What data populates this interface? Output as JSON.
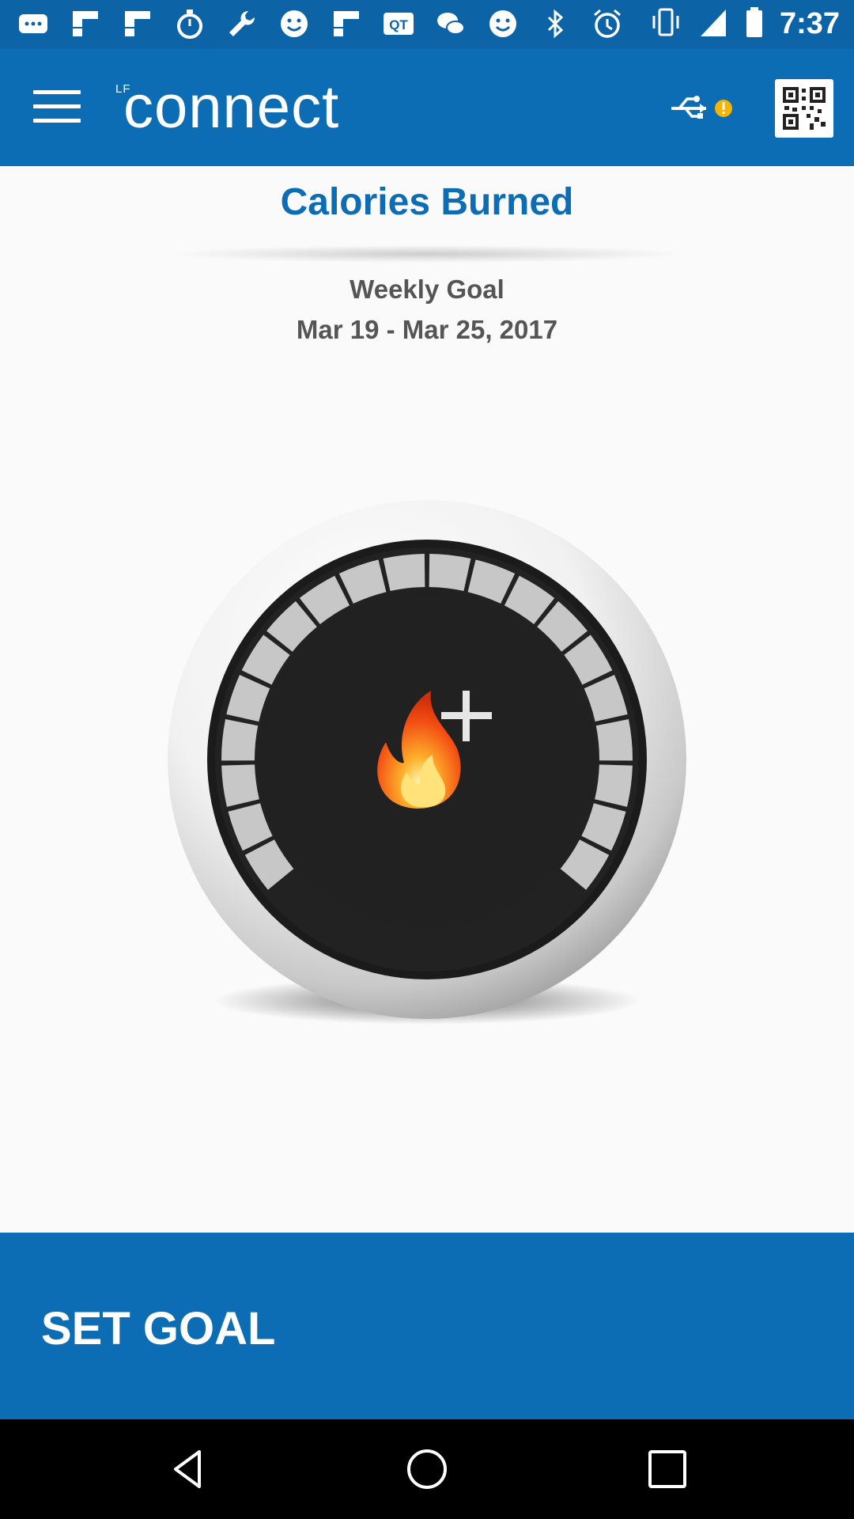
{
  "status_bar": {
    "time": "7:37",
    "icons": [
      "chat-icon",
      "flipboard-icon",
      "flipboard-icon",
      "stopwatch-icon",
      "wrench-icon",
      "smiley-icon",
      "flipboard-icon",
      "qq-icon",
      "wechat-icon",
      "smiley-icon",
      "bluetooth-icon",
      "alarm-icon",
      "vibrate-icon",
      "signal-icon",
      "battery-icon"
    ]
  },
  "app_bar": {
    "logo_prefix": "LF",
    "logo_text": "connect",
    "icons": [
      "menu-icon",
      "usb-warning-icon",
      "qr-code-icon"
    ]
  },
  "main": {
    "title": "Calories Burned",
    "goal_label": "Weekly Goal",
    "date_range": "Mar 19 - Mar 25, 2017"
  },
  "gauge": {
    "icon": "flame-plus-icon",
    "progress": 0
  },
  "footer": {
    "set_goal_label": "SET GOAL"
  },
  "nav_bar": {
    "icons": [
      "back-icon",
      "home-icon",
      "recents-icon"
    ]
  },
  "colors": {
    "brand_blue": "#0c6db5",
    "status_blue": "#0c63a5",
    "gauge_dark": "#222222",
    "flame_orange": "#f25a12"
  }
}
